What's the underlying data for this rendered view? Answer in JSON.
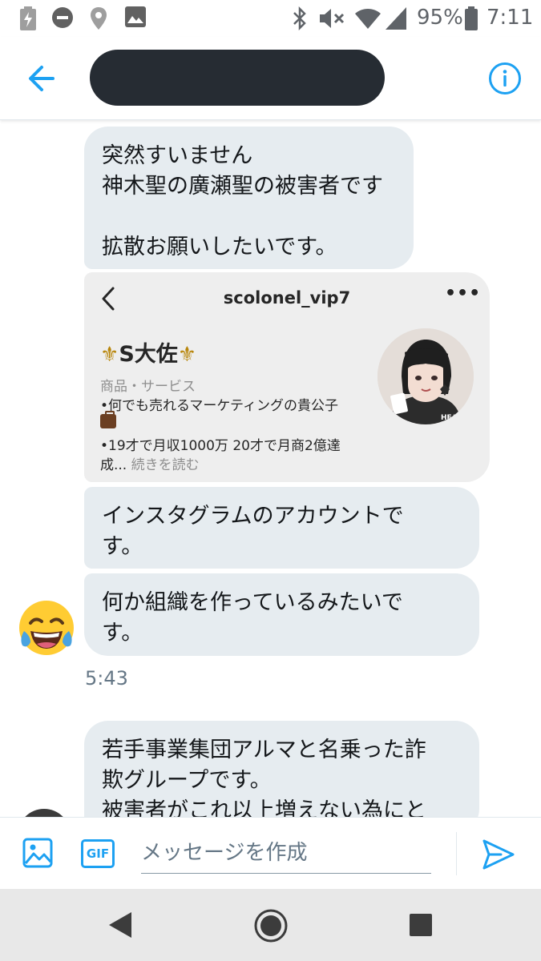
{
  "status_bar": {
    "battery": "95%",
    "time": "7:11",
    "icons": [
      "battery-charging-icon",
      "do-not-disturb-icon",
      "location-icon",
      "image-icon",
      "bluetooth-icon",
      "mute-icon",
      "wifi-icon",
      "signal-icon",
      "battery-icon"
    ]
  },
  "header": {
    "back_icon": "back-arrow-icon",
    "info_icon": "info-icon",
    "accent_color": "#1da1f2"
  },
  "messages": [
    {
      "lines": [
        "突然すいません",
        "神木聖の廣瀬聖の被害者です",
        "",
        "拡散お願いしたいです。"
      ]
    },
    {
      "lines": [
        "インスタグラムのアカウントで",
        "す。"
      ]
    },
    {
      "lines": [
        "何か組織を作っているみたいで",
        "す。"
      ]
    },
    {
      "lines": [
        "若手事業集団アルマと名乗った詐",
        "欺グループです。",
        "被害者がこれ以上増えない為にと"
      ]
    }
  ],
  "profile_card": {
    "username": "scolonel_vip7",
    "more": "•••",
    "display_name": "S大佐",
    "fleur": "⚜",
    "category": "商品・サービス",
    "bio_lines": [
      "•何でも売れるマーケティングの貴公子",
      "•19才で月収1000万 20才で月商2億達",
      "成..."
    ],
    "read_more": "続きを読む",
    "avatar_text": "HEAR"
  },
  "timestamp": "5:43",
  "composer": {
    "placeholder": "メッセージを作成",
    "gif_label": "GIF"
  },
  "navbar": {
    "icons": [
      "nav-back-icon",
      "nav-home-icon",
      "nav-recents-icon"
    ]
  }
}
